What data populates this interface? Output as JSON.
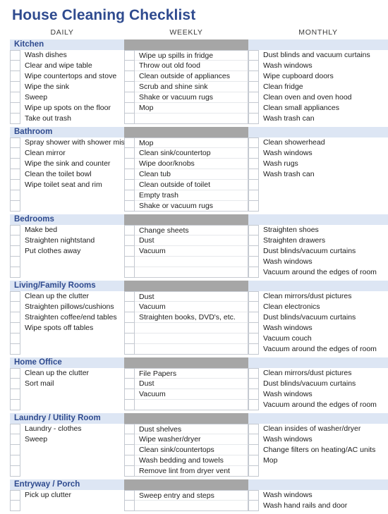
{
  "document": {
    "title": "House Cleaning Checklist",
    "accent_color": "#2f4b8f",
    "band_color": "#dde6f4",
    "grey_color": "#a6a6a6"
  },
  "columns": [
    {
      "key": "daily",
      "label": "DAILY"
    },
    {
      "key": "weekly",
      "label": "WEEKLY"
    },
    {
      "key": "monthly",
      "label": "MONTHLY"
    }
  ],
  "sections": [
    {
      "name": "Kitchen",
      "rows": 7,
      "daily": [
        "Wash dishes",
        "Clear and wipe table",
        "Wipe countertops and stove",
        "Wipe the sink",
        "Sweep",
        "Wipe up spots on the floor",
        "Take out trash"
      ],
      "weekly": [
        "Wipe up spills in fridge",
        "Throw out old food",
        "Clean outside of appliances",
        "Scrub and shine sink",
        "Shake or vacuum rugs",
        "Mop",
        ""
      ],
      "monthly": [
        "Dust blinds and vacuum curtains",
        "Wash windows",
        "Wipe cupboard doors",
        "Clean fridge",
        "Clean oven and oven hood",
        "Clean small appliances",
        "Wash trash can"
      ]
    },
    {
      "name": "Bathroom",
      "rows": 7,
      "daily": [
        "Spray shower with shower mist",
        "Clean mirror",
        "Wipe the sink and counter",
        "Clean the toilet bowl",
        "Wipe toilet seat and rim",
        "",
        ""
      ],
      "weekly": [
        "Mop",
        "Clean sink/countertop",
        "Wipe door/knobs",
        "Clean tub",
        "Clean outside of toilet",
        "Empty trash",
        "Shake or vacuum rugs"
      ],
      "monthly": [
        "Clean showerhead",
        "Wash windows",
        "Wash rugs",
        "Wash trash can",
        "",
        "",
        ""
      ]
    },
    {
      "name": "Bedrooms",
      "rows": 5,
      "daily": [
        "Make bed",
        "Straighten nightstand",
        "Put clothes away",
        "",
        ""
      ],
      "weekly": [
        "Change sheets",
        "Dust",
        "Vacuum",
        "",
        ""
      ],
      "monthly": [
        "Straighten shoes",
        "Straighten drawers",
        "Dust blinds/vacuum curtains",
        "Wash windows",
        "Vacuum around the edges of room"
      ]
    },
    {
      "name": "Living/Family Rooms",
      "rows": 6,
      "daily": [
        "Clean up the clutter",
        "Straighten pillows/cushions",
        "Straighten coffee/end tables",
        "Wipe spots off tables",
        "",
        ""
      ],
      "weekly": [
        "Dust",
        "Vacuum",
        "Straighten books, DVD's, etc.",
        "",
        "",
        ""
      ],
      "monthly": [
        "Clean mirrors/dust pictures",
        "Clean electronics",
        "Dust blinds/vacuum curtains",
        "Wash windows",
        "Vacuum couch",
        "Vacuum around the edges of room"
      ]
    },
    {
      "name": "Home Office",
      "rows": 4,
      "daily": [
        "Clean up the clutter",
        "Sort mail",
        "",
        ""
      ],
      "weekly": [
        "File Papers",
        "Dust",
        "Vacuum",
        ""
      ],
      "monthly": [
        "Clean mirrors/dust pictures",
        "Dust blinds/vacuum curtains",
        "Wash windows",
        "Vacuum around the edges of room"
      ]
    },
    {
      "name": "Laundry / Utility Room",
      "rows": 5,
      "daily": [
        "Laundry - clothes",
        "Sweep",
        "",
        "",
        ""
      ],
      "weekly": [
        "Dust shelves",
        "Wipe washer/dryer",
        "Clean sink/countertops",
        "Wash bedding and towels",
        "Remove lint from dryer vent"
      ],
      "monthly": [
        "Clean insides of washer/dryer",
        "Wash windows",
        "Change filters on heating/AC units",
        "Mop",
        ""
      ]
    },
    {
      "name": "Entryway / Porch",
      "rows": 2,
      "daily": [
        "Pick up clutter",
        ""
      ],
      "weekly": [
        "Sweep entry and steps",
        ""
      ],
      "monthly": [
        "Wash windows",
        "Wash hand rails and door"
      ]
    }
  ]
}
